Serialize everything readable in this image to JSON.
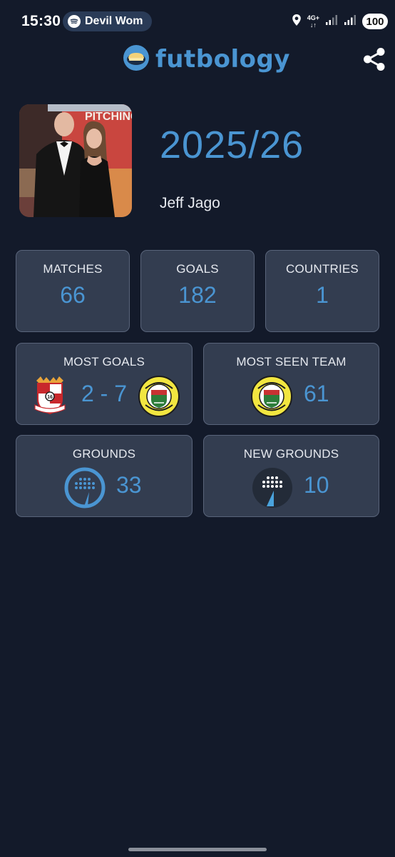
{
  "status_bar": {
    "time": "15:30",
    "media_text": "Devil Wom",
    "network_label": "4G+",
    "battery": "100"
  },
  "header": {
    "app_name": "futbology",
    "accent_color": "#4a95d2"
  },
  "profile": {
    "season": "2025/26",
    "name": "Jeff Jago",
    "photo_text": "PITCHING I"
  },
  "stats": {
    "matches": {
      "label": "MATCHES",
      "value": "66"
    },
    "goals": {
      "label": "GOALS",
      "value": "182"
    },
    "countries": {
      "label": "COUNTRIES",
      "value": "1"
    },
    "most_goals": {
      "label": "MOST GOALS",
      "score": "2 - 7"
    },
    "most_seen_team": {
      "label": "MOST SEEN TEAM",
      "value": "61"
    },
    "grounds": {
      "label": "GROUNDS",
      "value": "33"
    },
    "new_grounds": {
      "label": "NEW GROUNDS",
      "value": "10"
    }
  },
  "icons": {
    "home_crest": "tamworth-crest-icon",
    "away_crest": "runcorn-linnets-crest-icon",
    "grounds": "ground-icon",
    "new_grounds": "new-ground-icon",
    "share": "share-icon"
  }
}
